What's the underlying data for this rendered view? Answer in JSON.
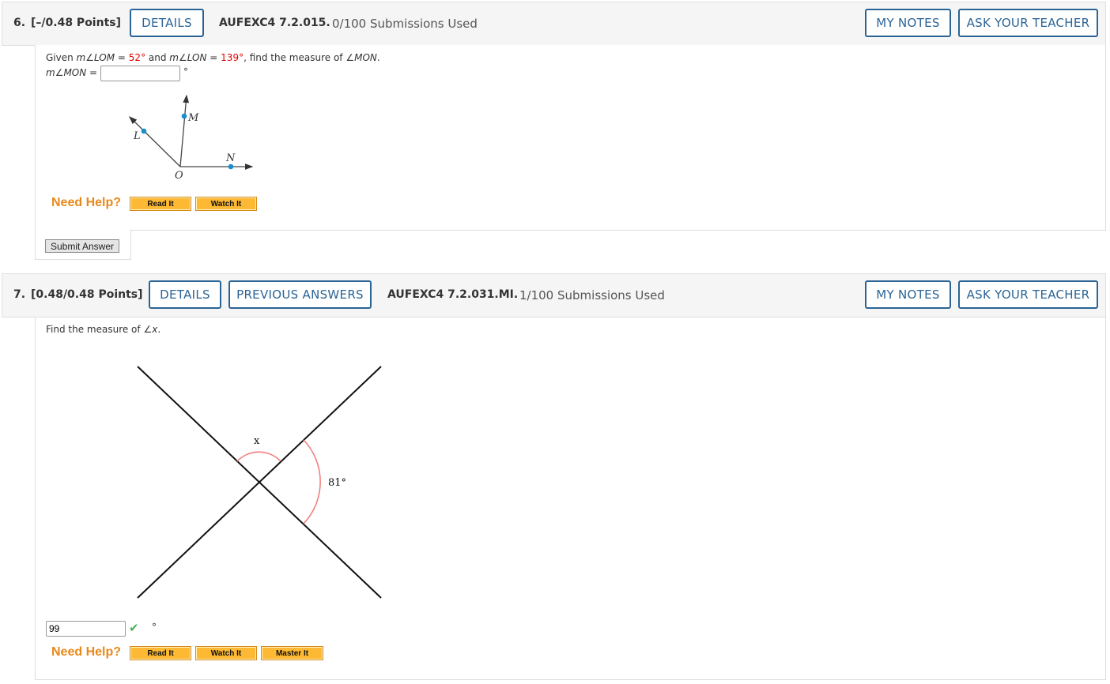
{
  "q6": {
    "number": "6.",
    "points": "[–/0.48 Points]",
    "details": "DETAILS",
    "code": "AUFEXC4 7.2.015.",
    "submissions": "0/100 Submissions Used",
    "my_notes": "MY NOTES",
    "ask": "ASK YOUR TEACHER",
    "prompt": {
      "given": "Given ",
      "m1": "m∠LOM",
      "eq1": " = ",
      "v1": "52°",
      "and": " and ",
      "m2": "m∠LON",
      "eq2": " = ",
      "v2": "139°",
      "rest": ", find the measure of ",
      "target": "∠MON",
      "end": "."
    },
    "answer_label": "m∠MON",
    "answer_eq": " = ",
    "answer_value": "",
    "degree": "°",
    "diagram": {
      "L": "L",
      "M": "M",
      "N": "N",
      "O": "O"
    },
    "need_help": "Need Help?",
    "read_it": "Read It",
    "watch_it": "Watch It",
    "submit": "Submit Answer"
  },
  "q7": {
    "number": "7.",
    "points": "[0.48/0.48 Points]",
    "details": "DETAILS",
    "previous": "PREVIOUS ANSWERS",
    "code": "AUFEXC4 7.2.031.MI.",
    "submissions": "1/100 Submissions Used",
    "my_notes": "MY NOTES",
    "ask": "ASK YOUR TEACHER",
    "prompt": "Find the measure of ",
    "target": "∠x",
    "end": ".",
    "diagram": {
      "x_label": "x",
      "angle_label": "81°"
    },
    "answer_value": "99",
    "degree": "°",
    "status": "correct-check-icon",
    "need_help": "Need Help?",
    "read_it": "Read It",
    "watch_it": "Watch It",
    "master_it": "Master It"
  },
  "colors": {
    "accent": "#2a6496",
    "help": "#e8891a",
    "button": "#fdb933",
    "highlight": "#dd0000",
    "arc": "#f08080",
    "point": "#1a8fc9",
    "check": "#4caf50"
  }
}
